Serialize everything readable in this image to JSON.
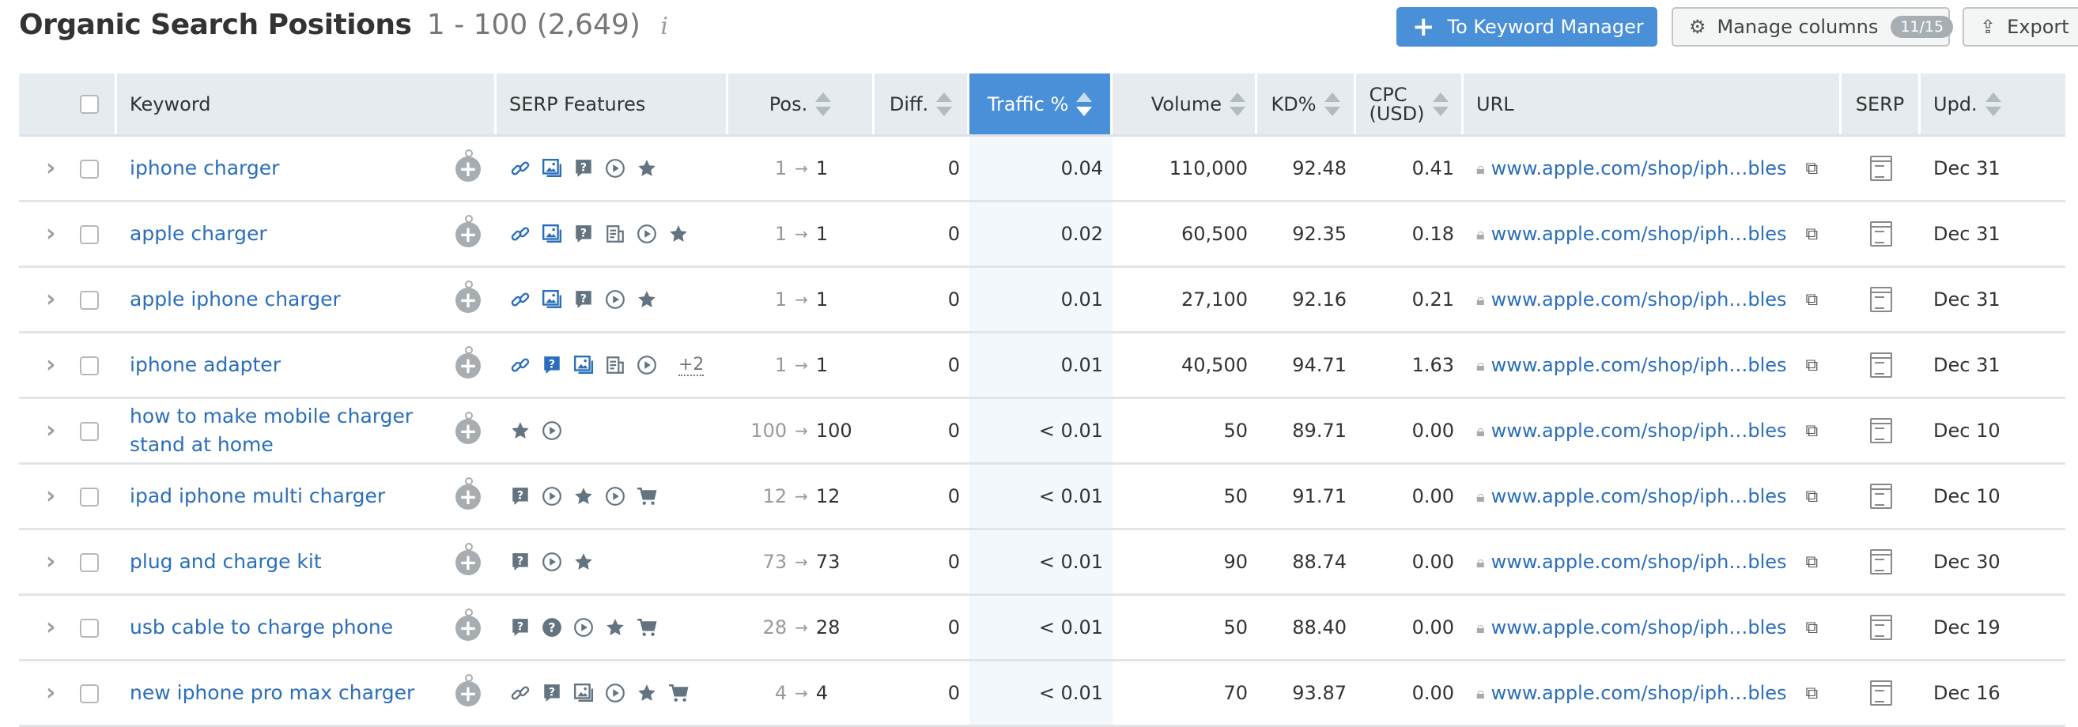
{
  "header": {
    "title": "Organic Search Positions",
    "range": "1 - 100 (2,649)",
    "info_icon": "i",
    "to_keyword_manager_label": "To Keyword Manager",
    "manage_columns_label": "Manage columns",
    "manage_columns_badge": "11/15",
    "export_label": "Export"
  },
  "columns": {
    "keyword": "Keyword",
    "serp_features": "SERP Features",
    "pos": "Pos.",
    "diff": "Diff.",
    "traffic": "Traffic %",
    "volume": "Volume",
    "kd": "KD%",
    "cpc_line1": "CPC",
    "cpc_line2": "(USD)",
    "url": "URL",
    "serp": "SERP",
    "upd": "Upd."
  },
  "colors": {
    "accent": "#4a90d9",
    "link": "#2a6ebb",
    "header_bg": "#e5ebef"
  },
  "rows": [
    {
      "keyword": "iphone charger",
      "serp_features": [
        "link",
        "image-pack",
        "faq",
        "video",
        "star"
      ],
      "more": "",
      "pos_prev": "1",
      "pos_cur": "1",
      "diff": "0",
      "traffic": "0.04",
      "volume": "110,000",
      "kd": "92.48",
      "cpc": "0.41",
      "url": "www.apple.com/shop/iph…bles",
      "upd": "Dec 31"
    },
    {
      "keyword": "apple charger",
      "serp_features": [
        "link",
        "image-pack",
        "faq",
        "news",
        "video",
        "star"
      ],
      "more": "",
      "pos_prev": "1",
      "pos_cur": "1",
      "diff": "0",
      "traffic": "0.02",
      "volume": "60,500",
      "kd": "92.35",
      "cpc": "0.18",
      "url": "www.apple.com/shop/iph…bles",
      "upd": "Dec 31"
    },
    {
      "keyword": "apple iphone charger",
      "serp_features": [
        "link",
        "image-pack",
        "faq",
        "video",
        "star"
      ],
      "more": "",
      "pos_prev": "1",
      "pos_cur": "1",
      "diff": "0",
      "traffic": "0.01",
      "volume": "27,100",
      "kd": "92.16",
      "cpc": "0.21",
      "url": "www.apple.com/shop/iph…bles",
      "upd": "Dec 31"
    },
    {
      "keyword": "iphone adapter",
      "serp_features": [
        "link",
        "faq-blue",
        "image-pack",
        "news",
        "video"
      ],
      "more": "+2",
      "pos_prev": "1",
      "pos_cur": "1",
      "diff": "0",
      "traffic": "0.01",
      "volume": "40,500",
      "kd": "94.71",
      "cpc": "1.63",
      "url": "www.apple.com/shop/iph…bles",
      "upd": "Dec 31"
    },
    {
      "keyword": "how to make mobile charger stand at home",
      "serp_features": [
        "star",
        "video"
      ],
      "more": "",
      "pos_prev": "100",
      "pos_cur": "100",
      "diff": "0",
      "traffic": "< 0.01",
      "volume": "50",
      "kd": "89.71",
      "cpc": "0.00",
      "url": "www.apple.com/shop/iph…bles",
      "upd": "Dec 10"
    },
    {
      "keyword": "ipad iphone multi charger",
      "serp_features": [
        "faq",
        "video",
        "star",
        "video",
        "cart"
      ],
      "more": "",
      "pos_prev": "12",
      "pos_cur": "12",
      "diff": "0",
      "traffic": "< 0.01",
      "volume": "50",
      "kd": "91.71",
      "cpc": "0.00",
      "url": "www.apple.com/shop/iph…bles",
      "upd": "Dec 10"
    },
    {
      "keyword": "plug and charge kit",
      "serp_features": [
        "faq",
        "video",
        "star"
      ],
      "more": "",
      "pos_prev": "73",
      "pos_cur": "73",
      "diff": "0",
      "traffic": "< 0.01",
      "volume": "90",
      "kd": "88.74",
      "cpc": "0.00",
      "url": "www.apple.com/shop/iph…bles",
      "upd": "Dec 30"
    },
    {
      "keyword": "usb cable to charge phone",
      "serp_features": [
        "faq",
        "question",
        "video",
        "star",
        "cart"
      ],
      "more": "",
      "pos_prev": "28",
      "pos_cur": "28",
      "diff": "0",
      "traffic": "< 0.01",
      "volume": "50",
      "kd": "88.40",
      "cpc": "0.00",
      "url": "www.apple.com/shop/iph…bles",
      "upd": "Dec 19"
    },
    {
      "keyword": "new iphone pro max charger",
      "serp_features": [
        "link-gray",
        "faq",
        "image-pack-gray",
        "video",
        "star",
        "cart"
      ],
      "more": "",
      "pos_prev": "4",
      "pos_cur": "4",
      "diff": "0",
      "traffic": "< 0.01",
      "volume": "70",
      "kd": "93.87",
      "cpc": "0.00",
      "url": "www.apple.com/shop/iph…bles",
      "upd": "Dec 16"
    }
  ]
}
